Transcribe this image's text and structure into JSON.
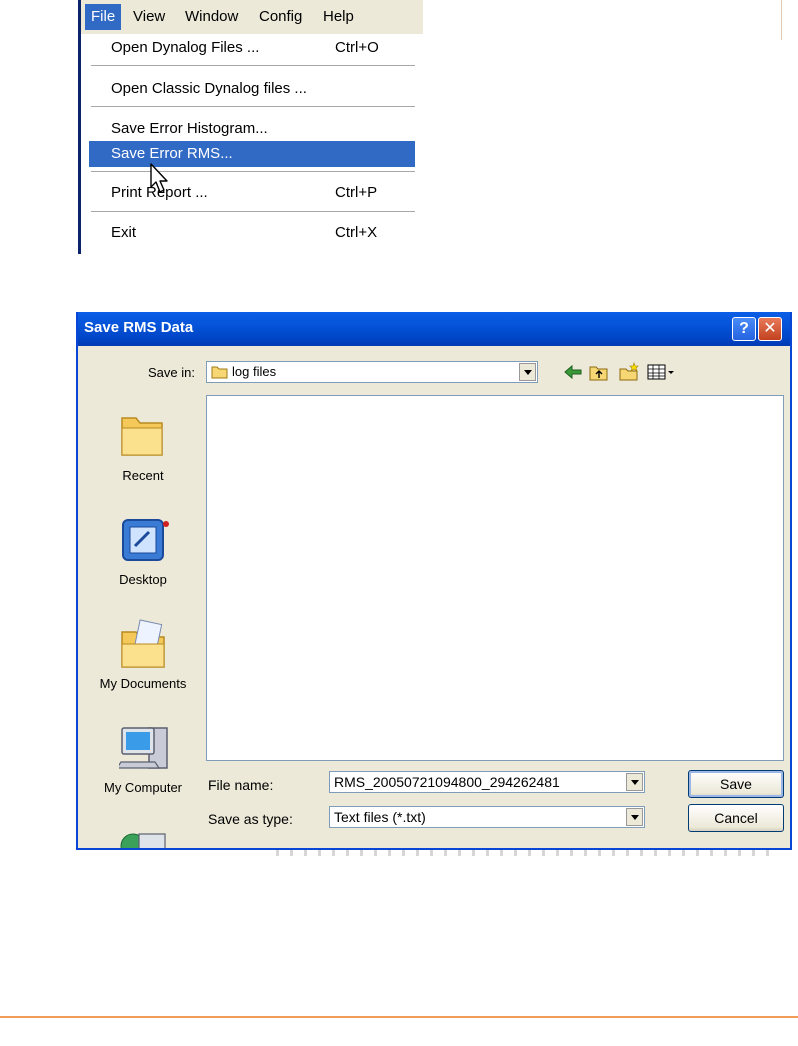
{
  "menubar": {
    "items": [
      {
        "label": "File"
      },
      {
        "label": "View"
      },
      {
        "label": "Window"
      },
      {
        "label": "Config"
      },
      {
        "label": "Help"
      }
    ]
  },
  "file_menu": {
    "items": [
      {
        "label": "Open Dynalog Files ...",
        "shortcut": "Ctrl+O"
      },
      {
        "label": "Open Classic Dynalog files ...",
        "shortcut": ""
      },
      {
        "label": "Save Error Histogram...",
        "shortcut": ""
      },
      {
        "label": "Save Error RMS...",
        "shortcut": "",
        "highlighted": true
      },
      {
        "label": "Print Report ...",
        "shortcut": "Ctrl+P"
      },
      {
        "label": "Exit",
        "shortcut": "Ctrl+X"
      }
    ]
  },
  "dialog": {
    "title": "Save RMS Data",
    "help_glyph": "?",
    "close_glyph": "✕",
    "save_in_label": "Save in:",
    "save_in_value": "log files",
    "places": [
      {
        "label": "Recent",
        "icon": "recent-folder-icon"
      },
      {
        "label": "Desktop",
        "icon": "desktop-icon"
      },
      {
        "label": "My Documents",
        "icon": "my-documents-icon"
      },
      {
        "label": "My Computer",
        "icon": "my-computer-icon"
      },
      {
        "label": "",
        "icon": "my-network-icon"
      }
    ],
    "file_name_label": "File name:",
    "file_name_value": "RMS_20050721094800_294262481",
    "save_as_type_label": "Save as type:",
    "save_as_type_value": "Text files (*.txt)",
    "save_button": "Save",
    "cancel_button": "Cancel"
  },
  "colors": {
    "menu_highlight": "#316ac5",
    "titlebar": "#0054e3",
    "dialog_bg": "#ece9d8",
    "accent_rule": "#f39c5a"
  }
}
